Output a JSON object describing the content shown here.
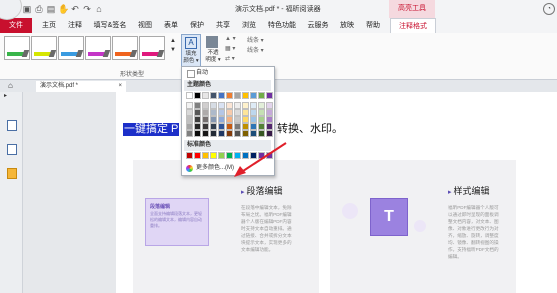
{
  "app": {
    "title": "演示文档.pdf * - 福昕阅读器",
    "context_group": "高亮工具"
  },
  "menu": {
    "file": "文件",
    "tabs": [
      "主页",
      "注释",
      "填写&签名",
      "视图",
      "表单",
      "保护",
      "共享",
      "浏览",
      "特色功能",
      "云服务",
      "放映",
      "帮助"
    ],
    "active_tab": "注释格式"
  },
  "ribbon": {
    "style_swatches": [
      "#39b54a",
      "#d5e600",
      "#3a9be0",
      "#c436c7",
      "#f0641e",
      "#e0197d"
    ],
    "style_group_label": "形状类型",
    "fill_label": "填充\n颜色 ▾",
    "opacity_label": "不透\n明度 ▾",
    "line_width_label": "线条 ▾",
    "line_style_label": "线条 ▾"
  },
  "doc_tab": {
    "label": "演示文档.pdf *",
    "close": "×"
  },
  "palette": {
    "auto_label": "自动",
    "theme_header": "主题颜色",
    "theme_top": [
      "#ffffff",
      "#000000",
      "#e7e6e6",
      "#44546a",
      "#4472c4",
      "#ed7d31",
      "#a5a5a5",
      "#ffc000",
      "#5b9bd5",
      "#70ad47",
      "#7030a0"
    ],
    "theme_shades": [
      [
        "#f2f2f2",
        "#7f7f7f",
        "#d0cece",
        "#d6dce4",
        "#d9e2f3",
        "#fbe5d5",
        "#ededed",
        "#fff2cc",
        "#deebf6",
        "#e2efd9",
        "#e2d4ec"
      ],
      [
        "#d8d8d8",
        "#595959",
        "#aeabab",
        "#adb9ca",
        "#b4c6e7",
        "#f7cbac",
        "#dbdbdb",
        "#fee599",
        "#bdd7ee",
        "#c5e0b3",
        "#c5a9d9"
      ],
      [
        "#bfbfbf",
        "#3f3f3f",
        "#757070",
        "#8496b0",
        "#8eaadb",
        "#f4b183",
        "#c9c9c9",
        "#ffd965",
        "#9dc3e6",
        "#a8d08d",
        "#a87fc6"
      ],
      [
        "#a5a5a5",
        "#262626",
        "#3a3838",
        "#323f4f",
        "#2f5496",
        "#c55a11",
        "#7b7b7b",
        "#bf9000",
        "#2e75b5",
        "#538135",
        "#53286c"
      ],
      [
        "#7f7f7f",
        "#0c0c0c",
        "#171616",
        "#222a35",
        "#1f3864",
        "#833c0b",
        "#525252",
        "#7f6000",
        "#1e4e79",
        "#375623",
        "#371b48"
      ]
    ],
    "standard_header": "标准颜色",
    "standard": [
      "#c00000",
      "#ff0000",
      "#ffc000",
      "#ffff00",
      "#92d050",
      "#00b050",
      "#00b0f0",
      "#0070c0",
      "#002060",
      "#7030a0",
      "#7030a0"
    ],
    "more_colors": "更多颜色...(M)"
  },
  "document": {
    "heading_highlighted": "一键搞定 P",
    "heading_rest": "转换、水印。",
    "card1": {
      "title": "段落编辑",
      "box_label": "段落编辑",
      "box_text": "全面支持编辑段落文本，更轻松的编辑文本，编辑内容自动重排。",
      "body": "在段落中编辑文本，免除布局之忧。福昕PDF编辑器个人版在编辑PDF内容时支持文本自动重排。通过链接、合并或拆分文本块提示文本，实现更多的文本编辑功能。"
    },
    "card2": {
      "title": "样式编辑",
      "body": "福昕PDF编辑器个人版可以通过即时呈现的面板调整文档内容，对文本、图像、对象进行更改行为对齐，缩放、旋转，调整度均、镜像、翻转视图的操作，支持福昕PDF文档的编辑。"
    }
  }
}
